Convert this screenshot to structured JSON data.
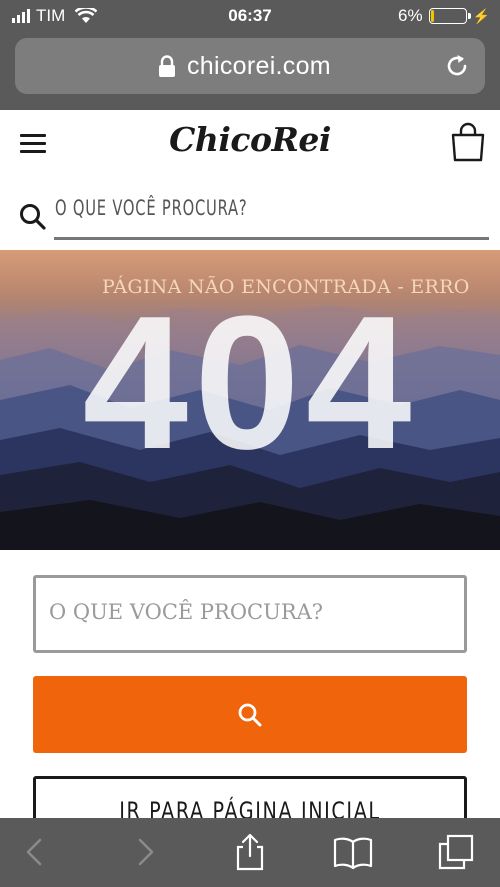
{
  "status_bar": {
    "carrier": "TIM",
    "time": "06:37",
    "battery": "6%",
    "battery_level": 0.06
  },
  "browser": {
    "url": "chicorei.com"
  },
  "header": {
    "logo": "ChicoRei",
    "search_placeholder": "O QUE VOCÊ PROCURA?"
  },
  "hero": {
    "subtitle": "PÁGINA NÃO ENCONTRADA - ERRO",
    "code": "404"
  },
  "form": {
    "search_placeholder": "O QUE VOCÊ PROCURA?",
    "home_button": "IR PARA PÁGINA INICIAL"
  },
  "colors": {
    "accent": "#f0640c",
    "chrome": "#5a5a5a"
  }
}
